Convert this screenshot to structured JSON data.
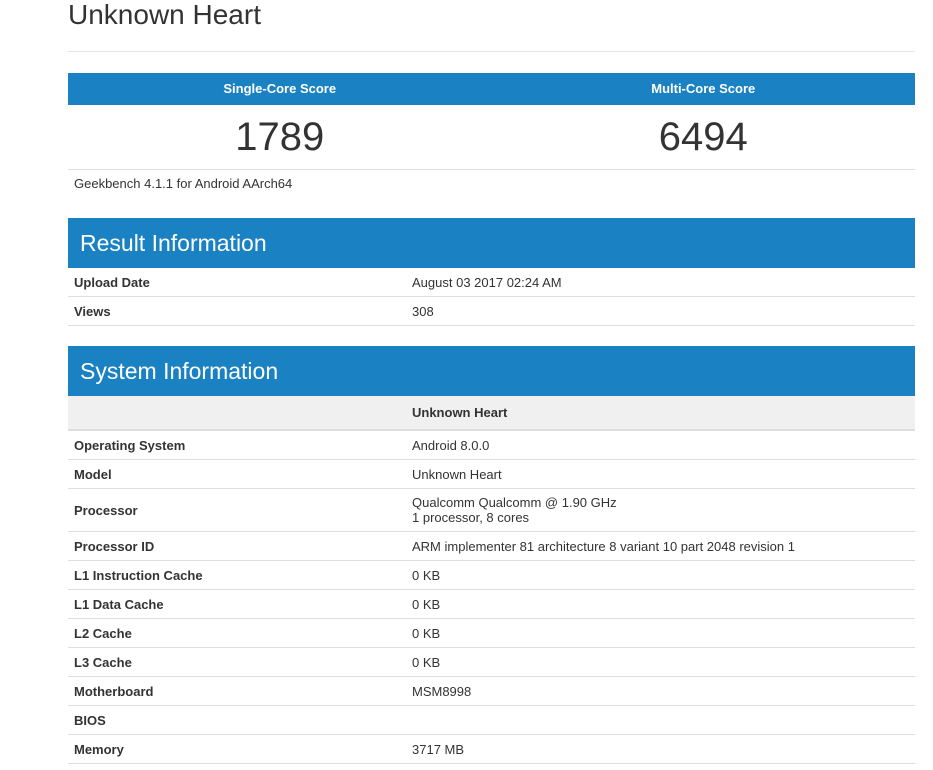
{
  "device": {
    "title": "Unknown Heart"
  },
  "scores": {
    "single_label": "Single-Core Score",
    "multi_label": "Multi-Core Score",
    "single_value": "1789",
    "multi_value": "6494",
    "version": "Geekbench 4.1.1 for Android AArch64"
  },
  "result": {
    "header": "Result Information",
    "rows": [
      {
        "label": "Upload Date",
        "value": "August 03 2017 02:24 AM"
      },
      {
        "label": "Views",
        "value": "308"
      }
    ]
  },
  "system": {
    "header": "System Information",
    "column_title": "Unknown Heart",
    "rows": [
      {
        "label": "Operating System",
        "value": "Android 8.0.0"
      },
      {
        "label": "Model",
        "value": "Unknown Heart"
      },
      {
        "label": "Processor",
        "value": "Qualcomm Qualcomm @ 1.90 GHz",
        "value2": "1 processor, 8 cores"
      },
      {
        "label": "Processor ID",
        "value": "ARM implementer 81 architecture 8 variant 10 part 2048 revision 1"
      },
      {
        "label": "L1 Instruction Cache",
        "value": "0 KB"
      },
      {
        "label": "L1 Data Cache",
        "value": "0 KB"
      },
      {
        "label": "L2 Cache",
        "value": "0 KB"
      },
      {
        "label": "L3 Cache",
        "value": "0 KB"
      },
      {
        "label": "Motherboard",
        "value": "MSM8998"
      },
      {
        "label": "BIOS",
        "value": ""
      },
      {
        "label": "Memory",
        "value": "3717 MB"
      }
    ]
  }
}
